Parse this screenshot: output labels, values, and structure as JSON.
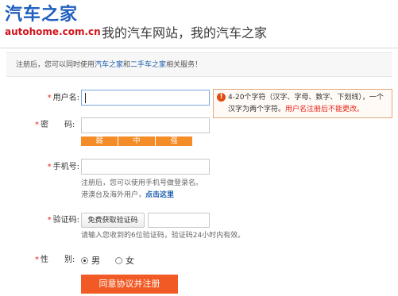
{
  "header": {
    "logo_cn": "汽车之家",
    "logo_en": "autohome.com.cn",
    "slogan": "我的汽车网站，我的汽车之家"
  },
  "notice": {
    "prefix": "注册后，您可以同时使用",
    "link1": "汽车之家",
    "mid": "和",
    "link2": "二手车之家",
    "suffix": "相关服务！"
  },
  "form": {
    "username_label": "用户名:",
    "username_value": "",
    "username_tip_line1": "4-20个字符（汉字、字母、数字、下划线），一个",
    "username_tip_line2a": "汉字为两个字符。",
    "username_tip_line2b": "用户名注册后不能更改。",
    "password_label_a": "密",
    "password_label_b": "码:",
    "strength": [
      "弱",
      "中",
      "强"
    ],
    "phone_label": "手机号:",
    "phone_hint1": "注册后，您可以使用手机号做登录名。",
    "phone_hint2_prefix": "港澳台及海外用户，",
    "phone_hint2_link": "点击这里",
    "code_label": "验证码:",
    "code_button": "免费获取验证码",
    "code_hint": "请输入您收到的6位验证码，验证码24小时内有效。",
    "gender_label_a": "性",
    "gender_label_b": "别:",
    "gender_male": "男",
    "gender_female": "女",
    "gender_selected": "男",
    "submit_label": "同意协议并注册"
  },
  "required_mark": "*"
}
